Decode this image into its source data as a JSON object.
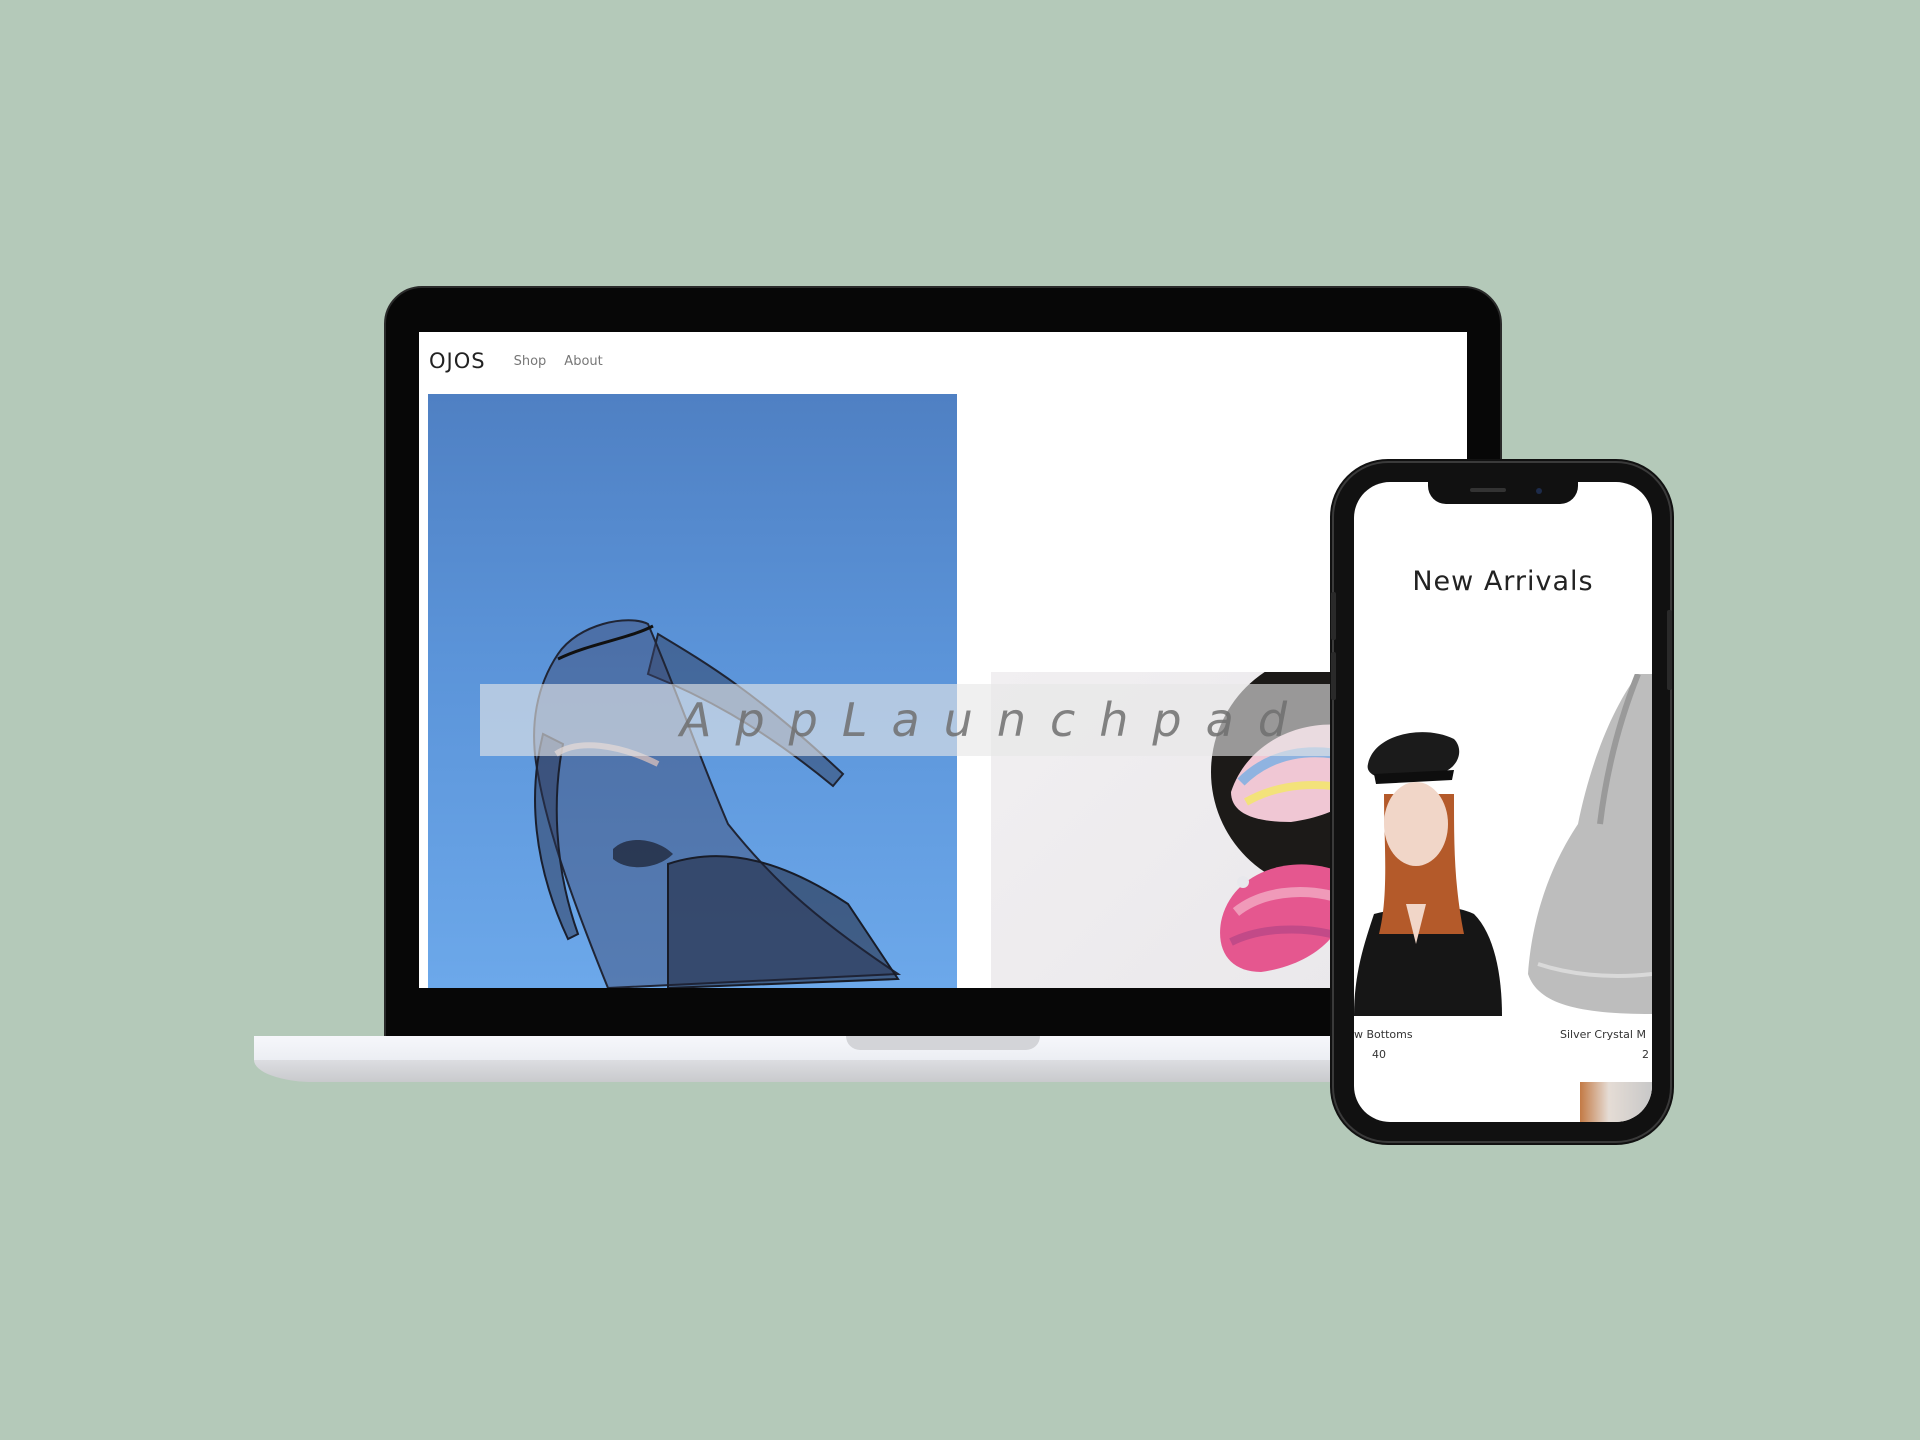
{
  "site": {
    "logo": "OJOS",
    "nav": [
      {
        "label": "Shop"
      },
      {
        "label": "About"
      }
    ]
  },
  "watermark": "AppLaunchpad",
  "mobile": {
    "heading": "New Arrivals",
    "products": [
      {
        "name": "w Bottoms",
        "price": "40"
      },
      {
        "name": "Silver Crystal M",
        "price": "2"
      }
    ]
  },
  "colors": {
    "background": "#b4c9b9",
    "hero_sky": "#5b94d9",
    "device_frame": "#070707"
  }
}
